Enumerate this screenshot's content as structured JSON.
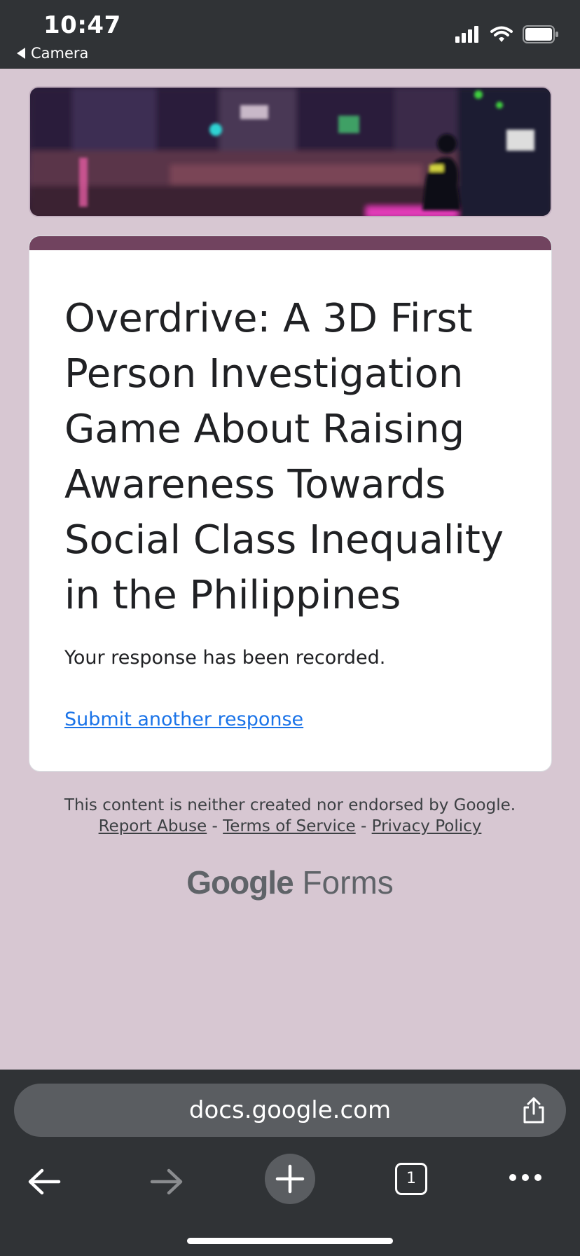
{
  "status_bar": {
    "time": "10:47",
    "back_app": "Camera",
    "icons": [
      "cellular-signal-icon",
      "wifi-icon",
      "battery-icon"
    ]
  },
  "form": {
    "title": "Overdrive: A 3D First Person Investigation Game About Raising Awareness Towards Social Class Inequality in the Philippines",
    "message": "Your response has been recorded.",
    "submit_another": "Submit another response",
    "accent_color": "#71435f"
  },
  "footer": {
    "disclaimer": "This content is neither created nor endorsed by Google.",
    "report_abuse": "Report Abuse",
    "separator": "-",
    "terms": "Terms of Service",
    "privacy": "Privacy Policy",
    "brand_google": "Google",
    "brand_forms": "Forms"
  },
  "browser": {
    "url": "docs.google.com",
    "tab_count": "1",
    "icons": [
      "share-icon",
      "back-arrow-icon",
      "forward-arrow-icon",
      "new-tab-plus-icon",
      "tabs-icon",
      "more-icon"
    ]
  }
}
